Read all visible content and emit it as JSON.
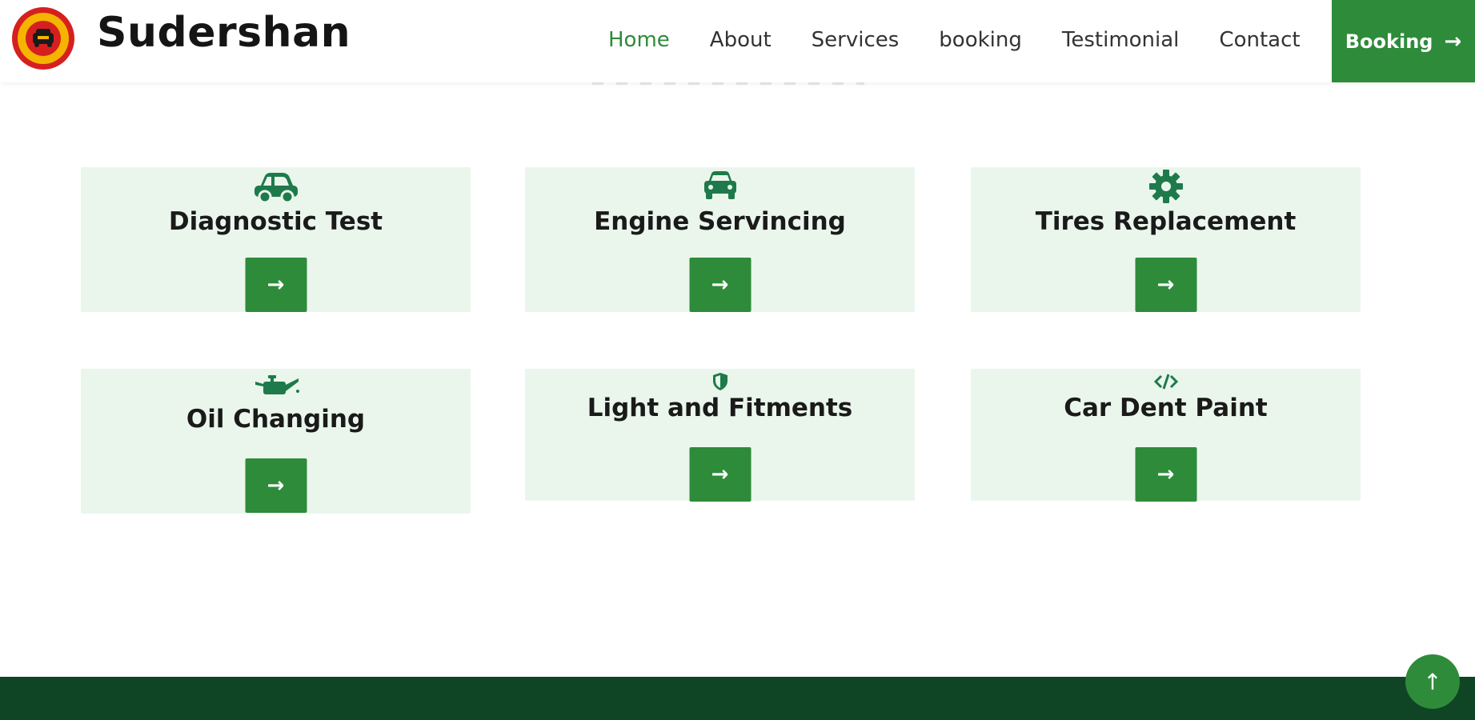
{
  "brand": {
    "name": "Sudershan",
    "logo_icon": "car-badge-logo"
  },
  "nav": {
    "items": [
      "Home",
      "About",
      "Services",
      "booking",
      "Testimonial",
      "Contact"
    ],
    "active": "Home",
    "booking_label": "Booking",
    "booking_arrow": "→"
  },
  "services": [
    {
      "title": "Diagnostic Test",
      "icon": "car-side-icon"
    },
    {
      "title": "Engine Servincing",
      "icon": "car-front-icon"
    },
    {
      "title": "Tires Replacement",
      "icon": "gear-icon"
    },
    {
      "title": "Oil Changing",
      "icon": "oil-can-icon"
    },
    {
      "title": "Light and Fitments",
      "icon": "shield-icon"
    },
    {
      "title": "Car Dent Paint",
      "icon": "code-icon"
    }
  ],
  "card_arrow": "→",
  "back_to_top": "↑",
  "colors": {
    "accent": "#2e8b3a",
    "icon": "#1e7a4a",
    "card_bg": "#eaf6ec",
    "footer": "#0f4524"
  }
}
